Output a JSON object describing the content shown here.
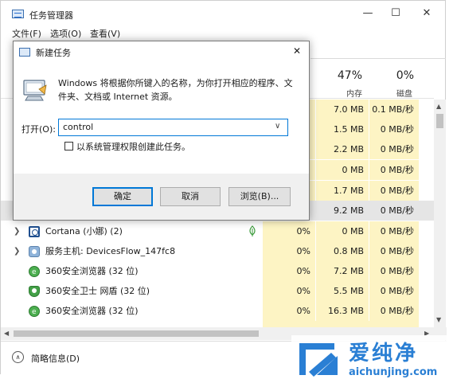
{
  "window": {
    "title": "任务管理器",
    "minimize": "—",
    "maximize": "☐",
    "close": "✕"
  },
  "menu": [
    "文件(F)",
    "选项(O)",
    "查看(V)"
  ],
  "columns": {
    "memory": {
      "percent": "47%",
      "label": "内存"
    },
    "disk": {
      "percent": "0%",
      "label": "磁盘"
    }
  },
  "partial_rows": [
    {
      "memory": "7.0 MB",
      "disk": "0.1 MB/秒"
    },
    {
      "memory": "1.5 MB",
      "disk": "0 MB/秒"
    },
    {
      "memory": "2.2 MB",
      "disk": "0 MB/秒"
    },
    {
      "memory": "0 MB",
      "disk": "0 MB/秒"
    },
    {
      "memory": "1.7 MB",
      "disk": "0 MB/秒"
    },
    {
      "memory": "9.2 MB",
      "disk": "0 MB/秒"
    }
  ],
  "processes": [
    {
      "name": "Cortana (小娜) (2)",
      "cpu": "0%",
      "memory": "0 MB",
      "disk": "0 MB/秒"
    },
    {
      "name": "服务主机: DevicesFlow_147fc8",
      "cpu": "0%",
      "memory": "0.8 MB",
      "disk": "0 MB/秒"
    },
    {
      "name": "360安全浏览器 (32 位)",
      "cpu": "0%",
      "memory": "7.2 MB",
      "disk": "0 MB/秒"
    },
    {
      "name": "360安全卫士 网盾 (32 位)",
      "cpu": "0%",
      "memory": "5.5 MB",
      "disk": "0 MB/秒"
    },
    {
      "name": "360安全浏览器 (32 位)",
      "cpu": "0%",
      "memory": "16.3 MB",
      "disk": "0 MB/秒"
    }
  ],
  "footer": {
    "label": "简略信息(D)"
  },
  "dialog": {
    "title": "新建任务",
    "close": "✕",
    "description": "Windows 将根据你所键入的名称，为你打开相应的程序、文件夹、文档或 Internet 资源。",
    "open_label": "打开(O):",
    "open_value": "control",
    "admin_checkbox": "以系统管理权限创建此任务。",
    "ok": "确定",
    "cancel": "取消",
    "browse": "浏览(B)..."
  },
  "watermark": {
    "brand": "爱纯净",
    "url": "aichunjing.com"
  },
  "colors": {
    "accent": "#0078d7",
    "highlight": "#fdf4c4",
    "brand": "#2a7fd4"
  }
}
